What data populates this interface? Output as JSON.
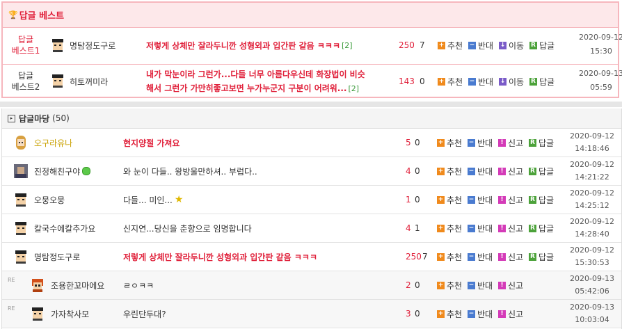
{
  "best": {
    "title": "답글 베스트",
    "rows": [
      {
        "label1": "답글",
        "label2": "베스트1",
        "nick": "명탐정도구로",
        "content": "저렇게 상체만 잘라두니깐 성형외과 입간판 같음 ㅋㅋㅋ",
        "comments": "[2]",
        "up": "250",
        "down": "7",
        "date": "2020-09-12",
        "time": "15:30"
      },
      {
        "label1": "답글",
        "label2": "베스트2",
        "nick": "히토꺼미라",
        "content_line1": "내가 막눈이라 그런가...다들 너무 아름다우신데 화장법이 비슷",
        "content_line2": "해서 그런가 가만히좋고보면 누가누군지 구분이 어려워...",
        "comments": "[2]",
        "up": "143",
        "down": "0",
        "date": "2020-09-13",
        "time": "05:59"
      }
    ],
    "actions": {
      "recommend": "추천",
      "oppose": "반대",
      "move": "이동",
      "reply": "답글"
    }
  },
  "madang": {
    "title": "답글마당",
    "count": "(50)",
    "actions": {
      "recommend": "추천",
      "oppose": "반대",
      "report": "신고",
      "reply": "답글"
    },
    "rows": [
      {
        "nick": "오구라유나",
        "content": "현지양절 가져요",
        "up": "5",
        "down": "0",
        "date": "2020-09-12",
        "time": "14:18:46"
      },
      {
        "nick": "진정해친구야",
        "content": "와 눈이 다들.. 왕방울만하셔.. 부럽다..",
        "up": "4",
        "down": "0",
        "date": "2020-09-12",
        "time": "14:21:22"
      },
      {
        "nick": "오뭉오뭉",
        "content": "다들... 미인...",
        "up": "1",
        "down": "0",
        "date": "2020-09-12",
        "time": "14:25:12"
      },
      {
        "nick": "칼국수에칼추가요",
        "content": "신지연...당신을 춘향으로 임명합니다",
        "up": "4",
        "down": "1",
        "date": "2020-09-12",
        "time": "14:28:40"
      },
      {
        "nick": "명탐정도구로",
        "content": "저렇게 상체만 잘라두니깐 성형외과 입간판 같음 ㅋㅋㅋ",
        "up": "250",
        "down": "7",
        "date": "2020-09-12",
        "time": "15:30:53"
      },
      {
        "re": "RE",
        "nick": "조용한꼬마에요",
        "content": "ㄹㅇㅋㅋ",
        "up": "2",
        "down": "0",
        "date": "2020-09-13",
        "time": "05:42:06"
      },
      {
        "re": "RE",
        "nick": "가자착사모",
        "content": "우린단두대?",
        "up": "3",
        "down": "0",
        "date": "2020-09-13",
        "time": "10:03:04"
      }
    ]
  }
}
